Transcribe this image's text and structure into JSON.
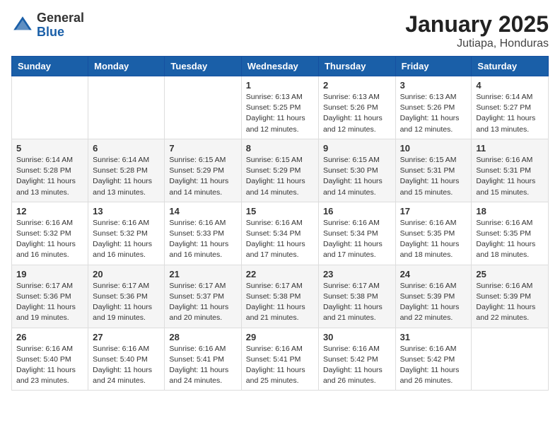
{
  "header": {
    "logo_general": "General",
    "logo_blue": "Blue",
    "month_title": "January 2025",
    "location": "Jutiapa, Honduras"
  },
  "days_of_week": [
    "Sunday",
    "Monday",
    "Tuesday",
    "Wednesday",
    "Thursday",
    "Friday",
    "Saturday"
  ],
  "weeks": [
    [
      {
        "day": "",
        "info": ""
      },
      {
        "day": "",
        "info": ""
      },
      {
        "day": "",
        "info": ""
      },
      {
        "day": "1",
        "info": "Sunrise: 6:13 AM\nSunset: 5:25 PM\nDaylight: 11 hours and 12 minutes."
      },
      {
        "day": "2",
        "info": "Sunrise: 6:13 AM\nSunset: 5:26 PM\nDaylight: 11 hours and 12 minutes."
      },
      {
        "day": "3",
        "info": "Sunrise: 6:13 AM\nSunset: 5:26 PM\nDaylight: 11 hours and 12 minutes."
      },
      {
        "day": "4",
        "info": "Sunrise: 6:14 AM\nSunset: 5:27 PM\nDaylight: 11 hours and 13 minutes."
      }
    ],
    [
      {
        "day": "5",
        "info": "Sunrise: 6:14 AM\nSunset: 5:28 PM\nDaylight: 11 hours and 13 minutes."
      },
      {
        "day": "6",
        "info": "Sunrise: 6:14 AM\nSunset: 5:28 PM\nDaylight: 11 hours and 13 minutes."
      },
      {
        "day": "7",
        "info": "Sunrise: 6:15 AM\nSunset: 5:29 PM\nDaylight: 11 hours and 14 minutes."
      },
      {
        "day": "8",
        "info": "Sunrise: 6:15 AM\nSunset: 5:29 PM\nDaylight: 11 hours and 14 minutes."
      },
      {
        "day": "9",
        "info": "Sunrise: 6:15 AM\nSunset: 5:30 PM\nDaylight: 11 hours and 14 minutes."
      },
      {
        "day": "10",
        "info": "Sunrise: 6:15 AM\nSunset: 5:31 PM\nDaylight: 11 hours and 15 minutes."
      },
      {
        "day": "11",
        "info": "Sunrise: 6:16 AM\nSunset: 5:31 PM\nDaylight: 11 hours and 15 minutes."
      }
    ],
    [
      {
        "day": "12",
        "info": "Sunrise: 6:16 AM\nSunset: 5:32 PM\nDaylight: 11 hours and 16 minutes."
      },
      {
        "day": "13",
        "info": "Sunrise: 6:16 AM\nSunset: 5:32 PM\nDaylight: 11 hours and 16 minutes."
      },
      {
        "day": "14",
        "info": "Sunrise: 6:16 AM\nSunset: 5:33 PM\nDaylight: 11 hours and 16 minutes."
      },
      {
        "day": "15",
        "info": "Sunrise: 6:16 AM\nSunset: 5:34 PM\nDaylight: 11 hours and 17 minutes."
      },
      {
        "day": "16",
        "info": "Sunrise: 6:16 AM\nSunset: 5:34 PM\nDaylight: 11 hours and 17 minutes."
      },
      {
        "day": "17",
        "info": "Sunrise: 6:16 AM\nSunset: 5:35 PM\nDaylight: 11 hours and 18 minutes."
      },
      {
        "day": "18",
        "info": "Sunrise: 6:16 AM\nSunset: 5:35 PM\nDaylight: 11 hours and 18 minutes."
      }
    ],
    [
      {
        "day": "19",
        "info": "Sunrise: 6:17 AM\nSunset: 5:36 PM\nDaylight: 11 hours and 19 minutes."
      },
      {
        "day": "20",
        "info": "Sunrise: 6:17 AM\nSunset: 5:36 PM\nDaylight: 11 hours and 19 minutes."
      },
      {
        "day": "21",
        "info": "Sunrise: 6:17 AM\nSunset: 5:37 PM\nDaylight: 11 hours and 20 minutes."
      },
      {
        "day": "22",
        "info": "Sunrise: 6:17 AM\nSunset: 5:38 PM\nDaylight: 11 hours and 21 minutes."
      },
      {
        "day": "23",
        "info": "Sunrise: 6:17 AM\nSunset: 5:38 PM\nDaylight: 11 hours and 21 minutes."
      },
      {
        "day": "24",
        "info": "Sunrise: 6:16 AM\nSunset: 5:39 PM\nDaylight: 11 hours and 22 minutes."
      },
      {
        "day": "25",
        "info": "Sunrise: 6:16 AM\nSunset: 5:39 PM\nDaylight: 11 hours and 22 minutes."
      }
    ],
    [
      {
        "day": "26",
        "info": "Sunrise: 6:16 AM\nSunset: 5:40 PM\nDaylight: 11 hours and 23 minutes."
      },
      {
        "day": "27",
        "info": "Sunrise: 6:16 AM\nSunset: 5:40 PM\nDaylight: 11 hours and 24 minutes."
      },
      {
        "day": "28",
        "info": "Sunrise: 6:16 AM\nSunset: 5:41 PM\nDaylight: 11 hours and 24 minutes."
      },
      {
        "day": "29",
        "info": "Sunrise: 6:16 AM\nSunset: 5:41 PM\nDaylight: 11 hours and 25 minutes."
      },
      {
        "day": "30",
        "info": "Sunrise: 6:16 AM\nSunset: 5:42 PM\nDaylight: 11 hours and 26 minutes."
      },
      {
        "day": "31",
        "info": "Sunrise: 6:16 AM\nSunset: 5:42 PM\nDaylight: 11 hours and 26 minutes."
      },
      {
        "day": "",
        "info": ""
      }
    ]
  ]
}
